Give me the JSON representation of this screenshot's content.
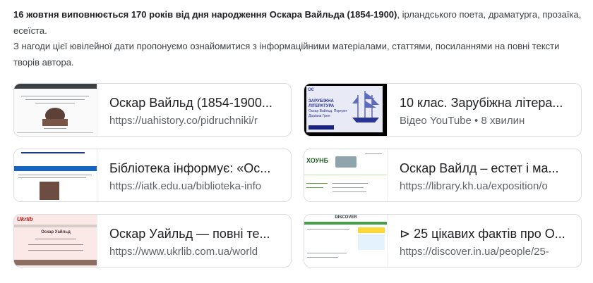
{
  "intro": {
    "bold": "16 жовтня виповнюється 170 років від дня народження Оскара Вайльда (1854-1900)",
    "rest": ", ірландського поета, драматурга, прозаїка, есеїста.",
    "line2": "З нагоди цієї ювілейної дати пропонуємо ознайомитися з інформаційними матеріалами, статтями, посиланнями на повні тексти творів автора."
  },
  "cards": [
    {
      "title": "Оскар Вайльд (1854-1900...",
      "sub": "https://uahistory.co/pidruchniki/r",
      "thumb_icon": "book-page-thumbnail"
    },
    {
      "title": "10 клас. Зарубіжна літера...",
      "sub": "Відео YouTube • 8 хвилин",
      "thumb_icon": "video-thumbnail",
      "thumb_text": [
        "ЗАРУБІЖНА",
        "ЛІТЕРАТУРА",
        "Оскар Вайльд. Портрет",
        "Доріана Грея"
      ]
    },
    {
      "title": "Бібліотека інформує: «Ос...",
      "sub": "https://iatk.edu.ua/biblioteka-info",
      "thumb_icon": "website-thumbnail"
    },
    {
      "title": "Оскар Вайлд – естет і ма...",
      "sub": "https://library.kh.ua/exposition/o",
      "thumb_icon": "library-thumbnail",
      "thumb_text": [
        "ХОУНБ"
      ]
    },
    {
      "title": "Оскар Уайльд — повні те...",
      "sub": "https://www.ukrlib.com.ua/world",
      "thumb_icon": "ukrlib-thumbnail",
      "thumb_text": [
        "Оскар Уайльд"
      ]
    },
    {
      "title": "⊳ 25 цікавих фактів про О...",
      "sub": "https://discover.in.ua/people/25-",
      "thumb_icon": "discover-thumbnail",
      "thumb_text": [
        "DISCOVER"
      ]
    }
  ]
}
